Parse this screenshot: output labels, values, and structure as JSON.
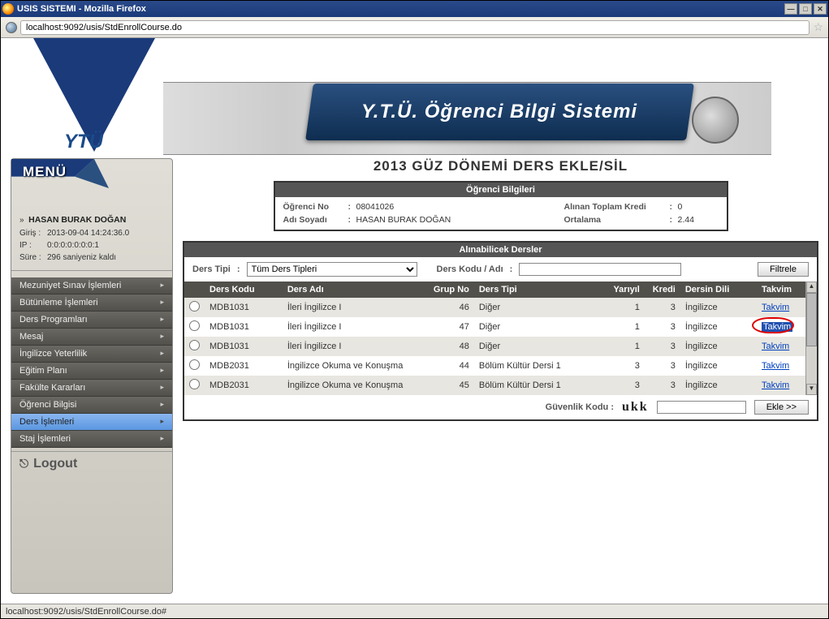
{
  "window": {
    "title": "USIS SISTEMI - Mozilla Firefox",
    "url": "localhost:9092/usis/StdEnrollCourse.do",
    "status": "localhost:9092/usis/StdEnrollCourse.do#"
  },
  "banner": {
    "title": "Y.T.Ü. Öğrenci Bilgi Sistemi",
    "logo_text": "YTÜ"
  },
  "sidebar": {
    "menu_label": "MENÜ",
    "user_prefix": "»",
    "user_name": "HASAN BURAK DOĞAN",
    "login_label": "Giriş :",
    "login_val": "2013-09-04 14:24:36.0",
    "ip_label": "IP    :",
    "ip_val": "0:0:0:0:0:0:0:1",
    "duration_label": "Süre :",
    "duration_val": "296 saniyeniz kaldı",
    "items": [
      {
        "label": "Mezuniyet Sınav İşlemleri"
      },
      {
        "label": "Bütünleme İşlemleri"
      },
      {
        "label": "Ders Programları"
      },
      {
        "label": "Mesaj"
      },
      {
        "label": "İngilizce Yeterlilik"
      },
      {
        "label": "Eğitim Planı"
      },
      {
        "label": "Fakülte Kararları"
      },
      {
        "label": "Öğrenci Bilgisi"
      },
      {
        "label": "Ders İşlemleri"
      },
      {
        "label": "Staj İşlemleri"
      }
    ],
    "logout": "Logout"
  },
  "page": {
    "title": "2013 GÜZ DÖNEMİ DERS EKLE/SİL"
  },
  "student": {
    "header": "Öğrenci Bilgileri",
    "no_label": "Öğrenci No",
    "no_val": "08041026",
    "name_label": "Adı Soyadı",
    "name_val": "HASAN BURAK DOĞAN",
    "credit_label": "Alınan Toplam Kredi",
    "credit_val": "0",
    "avg_label": "Ortalama",
    "avg_val": "2.44"
  },
  "courses": {
    "header": "Alınabilicek Dersler",
    "type_label": "Ders Tipi",
    "type_select": "Tüm Ders Tipleri",
    "code_label": "Ders Kodu / Adı",
    "code_val": "",
    "filter_btn": "Filtrele",
    "cols": {
      "code": "Ders Kodu",
      "name": "Ders Adı",
      "group": "Grup No",
      "type": "Ders Tipi",
      "sem": "Yarıyıl",
      "credit": "Kredi",
      "lang": "Dersin Dili",
      "cal": "Takvim"
    },
    "rows": [
      {
        "code": "MDB1031",
        "name": "İleri İngilizce I",
        "group": "46",
        "type": "Diğer",
        "sem": "1",
        "credit": "3",
        "lang": "İngilizce",
        "cal": "Takvim",
        "hl": false
      },
      {
        "code": "MDB1031",
        "name": "İleri İngilizce I",
        "group": "47",
        "type": "Diğer",
        "sem": "1",
        "credit": "3",
        "lang": "İngilizce",
        "cal": "Takvim",
        "hl": true
      },
      {
        "code": "MDB1031",
        "name": "İleri İngilizce I",
        "group": "48",
        "type": "Diğer",
        "sem": "1",
        "credit": "3",
        "lang": "İngilizce",
        "cal": "Takvim",
        "hl": false
      },
      {
        "code": "MDB2031",
        "name": "İngilizce Okuma ve Konuşma",
        "group": "44",
        "type": "Bölüm Kültür Dersi 1",
        "sem": "3",
        "credit": "3",
        "lang": "İngilizce",
        "cal": "Takvim",
        "hl": false
      },
      {
        "code": "MDB2031",
        "name": "İngilizce Okuma ve Konuşma",
        "group": "45",
        "type": "Bölüm Kültür Dersi 1",
        "sem": "3",
        "credit": "3",
        "lang": "İngilizce",
        "cal": "Takvim",
        "hl": false
      }
    ],
    "security_label": "Güvenlik Kodu :",
    "captcha": "ukk",
    "security_val": "",
    "add_btn": "Ekle >>"
  }
}
